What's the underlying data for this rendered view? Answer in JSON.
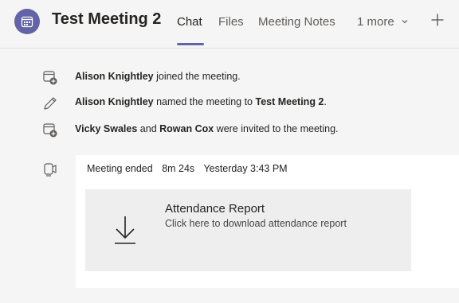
{
  "header": {
    "title": "Test Meeting 2",
    "tabs": [
      {
        "label": "Chat"
      },
      {
        "label": "Files"
      },
      {
        "label": "Meeting Notes"
      },
      {
        "label": "1 more"
      }
    ],
    "add_tab_icon": "plus-icon"
  },
  "events": [
    {
      "icon": "calendar-add-icon",
      "name": "Alison Knightley",
      "text": " joined the meeting."
    },
    {
      "icon": "pencil-icon",
      "name": "Alison Knightley",
      "text": " named the meeting to ",
      "target": "Test Meeting 2",
      "end": "."
    },
    {
      "icon": "calendar-add-icon",
      "name": "Vicky Swales",
      "and": " and ",
      "name2": "Rowan Cox",
      "text": " were invited to the meeting."
    }
  ],
  "meeting_card": {
    "status": "Meeting ended",
    "duration": "8m 24s",
    "time": "Yesterday 3:43 PM",
    "report_title": "Attendance Report",
    "report_subtitle": "Click here to download attendance report"
  },
  "colors": {
    "accent": "#6264a7",
    "background": "#f5f5f5",
    "card": "#ffffff",
    "report_bg": "#eeeeee"
  }
}
